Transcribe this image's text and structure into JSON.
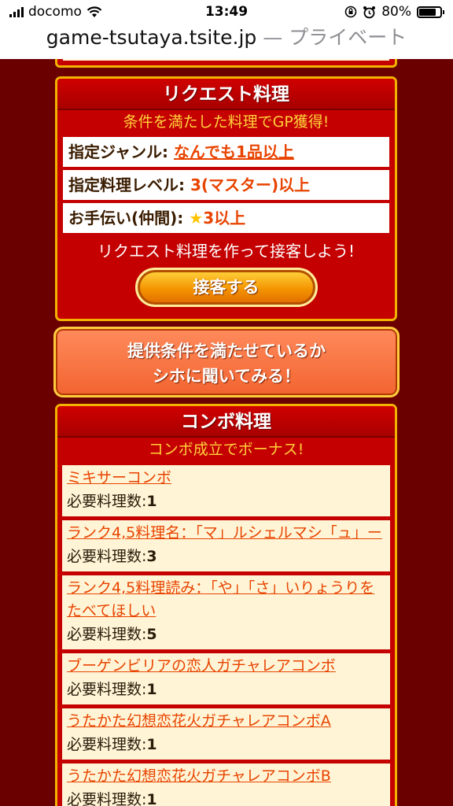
{
  "status_bar": {
    "carrier": "docomo",
    "time": "13:49",
    "battery": "80%",
    "battery_level": 0.8
  },
  "url_bar": {
    "domain": "game-tsutaya.tsite.jp",
    "private_label": "— プライベート"
  },
  "request_panel": {
    "title": "リクエスト料理",
    "subtitle": "条件を満たした料理でGP獲得!",
    "rows": [
      {
        "key": "指定ジャンル:",
        "value": "なんでも1品以上"
      },
      {
        "key": "指定料理レベル:",
        "value": "3(マスター)以上"
      },
      {
        "key": "お手伝い(仲間):",
        "star": "★",
        "value": "3以上"
      }
    ],
    "message": "リクエスト料理を作って接客しよう!",
    "serve_button": "接客する"
  },
  "ask_button": {
    "line1": "提供条件を満たせているか",
    "line2": "シホに聞いてみる！"
  },
  "combo_panel": {
    "title": "コンボ料理",
    "subtitle": "コンボ成立でボーナス!",
    "items": [
      {
        "name": "ミキサーコンボ",
        "req_label": "必要料理数:",
        "count": "1"
      },
      {
        "name": "ランク4,5料理名：「マ」ルシェルマシ「ュ」ー",
        "req_label": "必要料理数:",
        "count": "3"
      },
      {
        "name": "ランク4,5料理読み：「や」「さ」いりょうりをたべてほしい",
        "req_label": "必要料理数:",
        "count": "5"
      },
      {
        "name": "ブーゲンビリアの恋人ガチャレアコンボ",
        "req_label": "必要料理数:",
        "count": "1"
      },
      {
        "name": "うたかた幻想恋花火ガチャレアコンボA",
        "req_label": "必要料理数:",
        "count": "1"
      },
      {
        "name": "うたかた幻想恋花火ガチャレアコンボB",
        "req_label": "必要料理数:",
        "count": "1"
      }
    ]
  }
}
